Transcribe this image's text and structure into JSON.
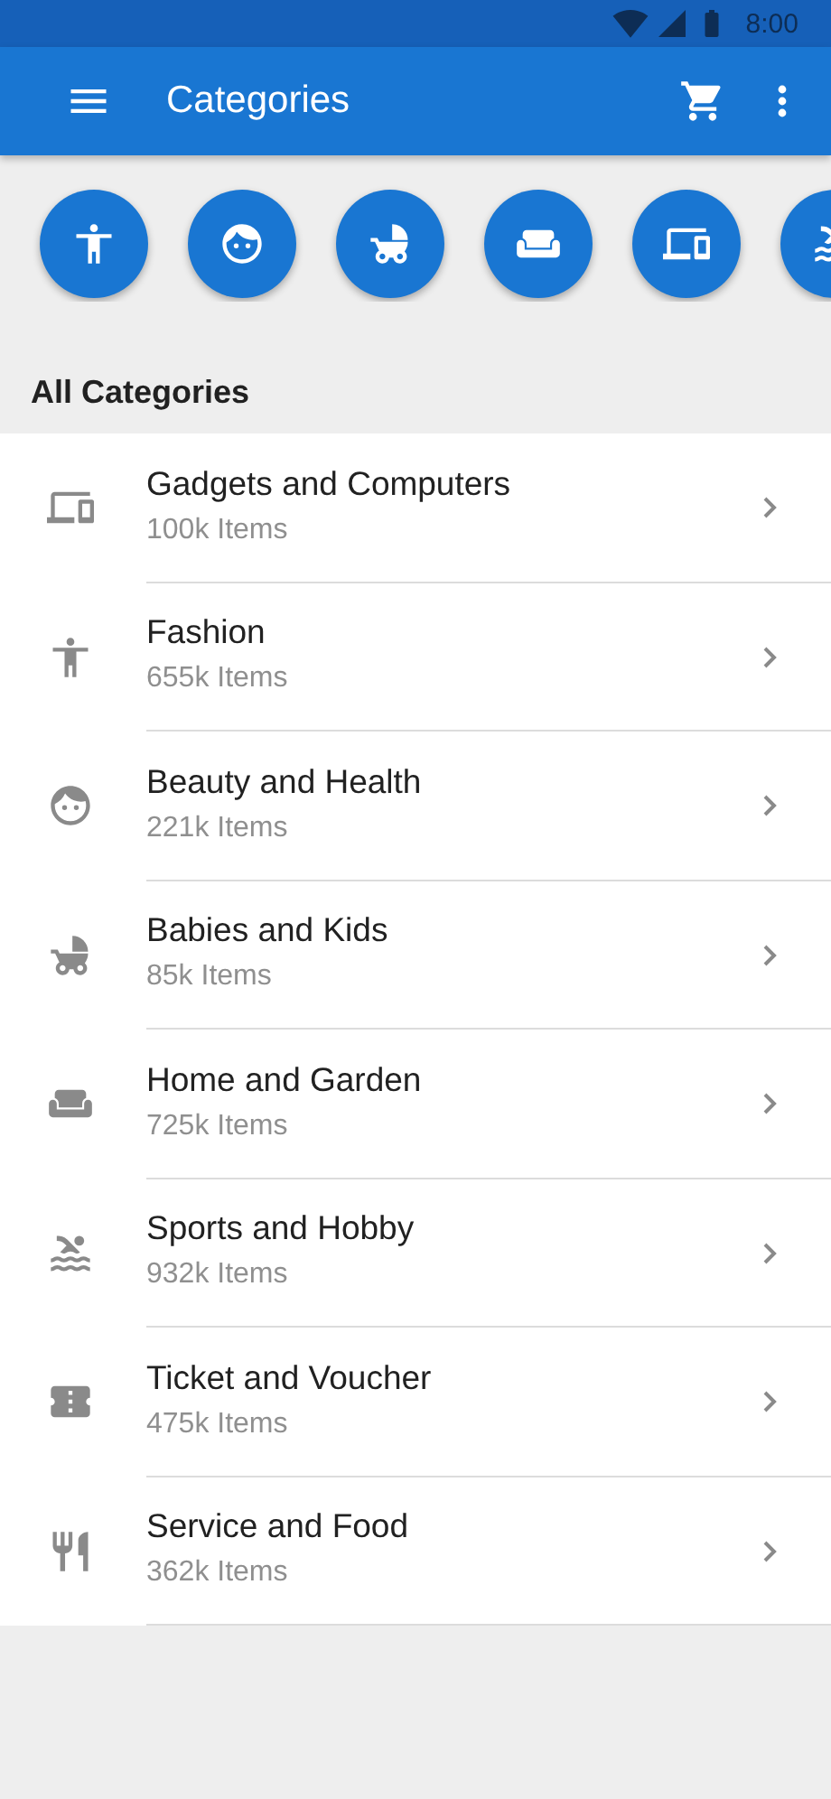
{
  "status_bar": {
    "time": "8:00"
  },
  "app_bar": {
    "title": "Categories"
  },
  "quick_categories": [
    {
      "kind": "accessibility"
    },
    {
      "kind": "face"
    },
    {
      "kind": "stroller"
    },
    {
      "kind": "sofa"
    },
    {
      "kind": "devices"
    },
    {
      "kind": "swim"
    }
  ],
  "section_title": "All Categories",
  "categories": [
    {
      "kind": "devices",
      "name": "Gadgets and Computers",
      "count": "100k Items"
    },
    {
      "kind": "accessibility",
      "name": "Fashion",
      "count": "655k Items"
    },
    {
      "kind": "face",
      "name": "Beauty and Health",
      "count": "221k Items"
    },
    {
      "kind": "stroller",
      "name": "Babies and Kids",
      "count": "85k Items"
    },
    {
      "kind": "sofa",
      "name": "Home and Garden",
      "count": "725k Items"
    },
    {
      "kind": "swim",
      "name": "Sports and Hobby",
      "count": "932k Items"
    },
    {
      "kind": "ticket",
      "name": "Ticket and Voucher",
      "count": "475k Items"
    },
    {
      "kind": "food",
      "name": "Service and Food",
      "count": "362k Items"
    }
  ]
}
